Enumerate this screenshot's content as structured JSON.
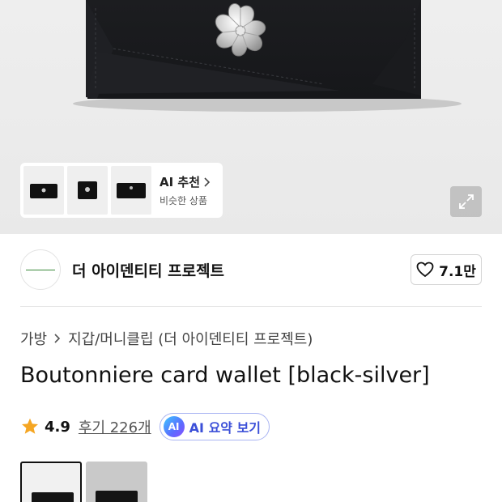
{
  "hero": {
    "image": "black card wallet with silver flower ornament",
    "thumbnails": [
      {
        "icon": "wallet-thumb-1"
      },
      {
        "icon": "wallet-thumb-2"
      },
      {
        "icon": "wallet-thumb-3"
      }
    ],
    "ai_recommend": {
      "title": "AI 추천",
      "subtitle": "비슷한 상품"
    },
    "zoom_icon": "expand-icon"
  },
  "brand": {
    "name": "더 아이덴티티 프로젝트",
    "like_count": "7.1만",
    "like_icon": "heart-icon"
  },
  "breadcrumb": {
    "category": "가방",
    "subcategory": "지갑/머니클립 (더 아이덴티티 프로젝트)"
  },
  "product": {
    "title": "Boutonniere card wallet [black-silver]",
    "rating": "4.9",
    "reviews": "후기 226개",
    "ai_badge": "AI",
    "ai_summary": "AI 요약 보기"
  },
  "colors": {
    "star": "#f5a623",
    "ai_text": "#3b4fd8"
  }
}
